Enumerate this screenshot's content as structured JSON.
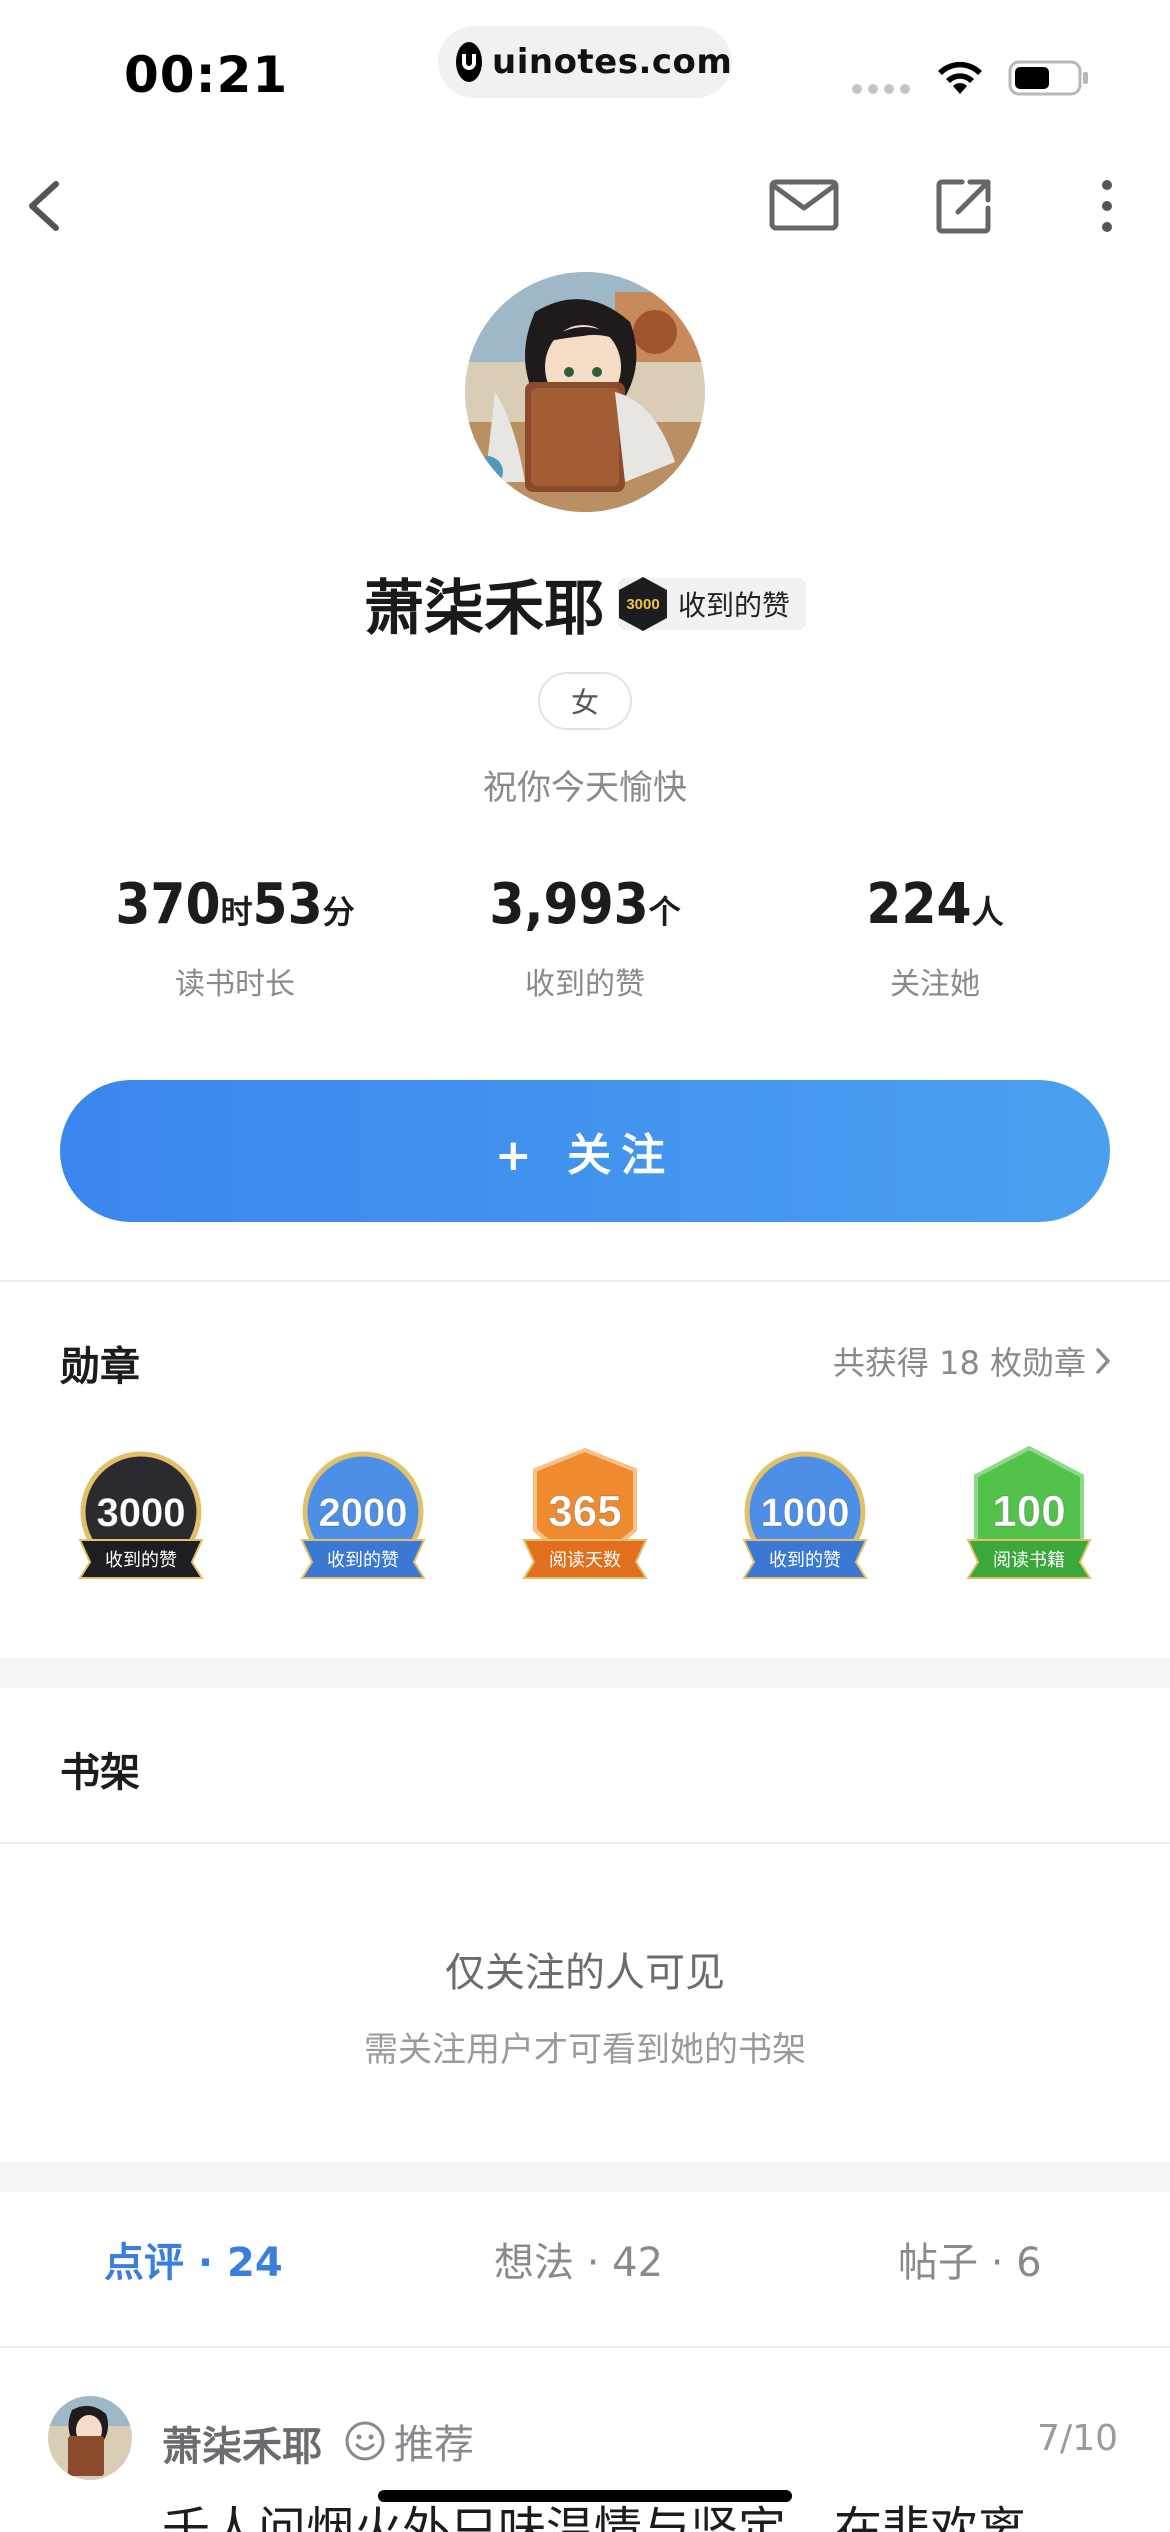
{
  "status_bar": {
    "time": "00:21",
    "url": "uinotes.com"
  },
  "nav": {
    "back_icon": "chevron-left-icon",
    "mail_icon": "mail-icon",
    "share_icon": "share-icon",
    "more_icon": "more-vertical-icon"
  },
  "profile": {
    "name": "萧柒禾耶",
    "badge_number": "3000",
    "badge_label": "收到的赞",
    "gender": "女",
    "bio": "祝你今天愉快"
  },
  "stats": [
    {
      "parts": [
        {
          "v": "370",
          "u": "时"
        },
        {
          "v": "53",
          "u": "分"
        }
      ],
      "caption": "读书时长"
    },
    {
      "parts": [
        {
          "v": "3,993",
          "u": "个"
        }
      ],
      "caption": "收到的赞"
    },
    {
      "parts": [
        {
          "v": "224",
          "u": "人"
        }
      ],
      "caption": "关注她"
    }
  ],
  "follow_button": "+ 关注",
  "medals_section": {
    "title": "勋章",
    "count_text": "共获得 18 枚勋章",
    "medals": [
      {
        "number": "3000",
        "label": "收到的赞",
        "color": "#2b2b2f",
        "ribbon": "#1e1e22"
      },
      {
        "number": "2000",
        "label": "收到的赞",
        "color": "#4d8fe6",
        "ribbon": "#3a78d4"
      },
      {
        "number": "365",
        "label": "阅读天数",
        "color": "#ef8a2e",
        "ribbon": "#e26f1e"
      },
      {
        "number": "1000",
        "label": "收到的赞",
        "color": "#4d8fe6",
        "ribbon": "#3a78d4"
      },
      {
        "number": "100",
        "label": "阅读书籍",
        "color": "#52c24a",
        "ribbon": "#3aa83a"
      }
    ]
  },
  "shelf_section": {
    "title": "书架",
    "locked_title": "仅关注的人可见",
    "locked_subtitle": "需关注用户才可看到她的书架"
  },
  "tabs": [
    {
      "label": "点评 · 24",
      "active": true
    },
    {
      "label": "想法 · 42",
      "active": false
    },
    {
      "label": "帖子 · 6",
      "active": false
    }
  ],
  "review": {
    "user": "萧柒禾耶",
    "recommend": "推荐",
    "score": "7/10",
    "text": "千人问烟火外只味温情与坚定，在悲欢离"
  }
}
